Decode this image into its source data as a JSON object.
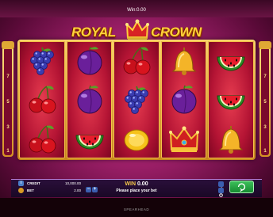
{
  "header": {
    "win_label": "Win:",
    "win_value": "0.00"
  },
  "logo": {
    "word_left": "ROYAL",
    "word_right": "CROWN"
  },
  "side_panels": {
    "left_top_label": "",
    "right_top_label": "",
    "left_numbers": [
      "7",
      "5",
      "3",
      "1"
    ],
    "right_numbers": [
      "7",
      "5",
      "3",
      "1"
    ]
  },
  "reels": [
    [
      "grapes",
      "cherries",
      "cherries"
    ],
    [
      "plum",
      "plum",
      "watermelon"
    ],
    [
      "cherries",
      "grapes",
      "lemon"
    ],
    [
      "bell",
      "plum",
      "crown"
    ],
    [
      "watermelon",
      "watermelon",
      "bell"
    ]
  ],
  "panel": {
    "credit_label": "CREDIT",
    "credit_value": "10,000.00",
    "bet_label": "BET",
    "bet_value": "2.00",
    "win_label": "WIN",
    "win_value": "0.00",
    "message": "Please place your bet",
    "minus_label": "−",
    "plus_label": "+"
  },
  "brand": "SPEARHEAD",
  "colors": {
    "background": "#9c1f68",
    "reel": "#b41434",
    "frame_gold": "#e8b040",
    "spin_button": "#28a844",
    "win_text": "#f6c84a"
  }
}
